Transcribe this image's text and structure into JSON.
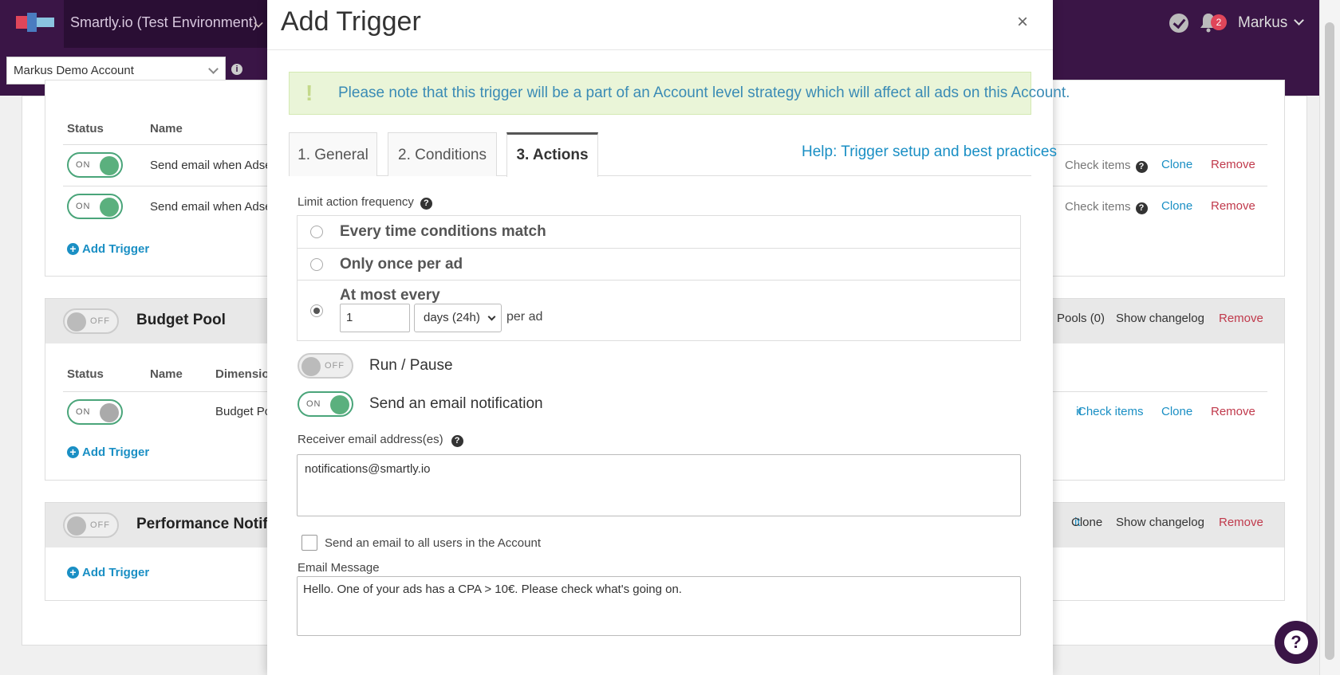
{
  "topbar": {
    "environment": "Smartly.io (Test Environment)",
    "notification_count": "2",
    "user_name": "Markus"
  },
  "account": {
    "selected": "Markus Demo Account",
    "info_icon": "i"
  },
  "panel1": {
    "columns": {
      "status": "Status",
      "name": "Name"
    },
    "rows": [
      {
        "toggle": "ON",
        "name": "Send email when Adse",
        "check_items": "Check items",
        "clone": "Clone",
        "remove": "Remove"
      },
      {
        "toggle": "ON",
        "name": "Send email when Adse",
        "check_items": "Check items",
        "clone": "Clone",
        "remove": "Remove"
      }
    ],
    "add_trigger": "Add Trigger"
  },
  "panel2": {
    "toggle": "OFF",
    "title": "Budget Pool",
    "pools": "Pools (0)",
    "show_changelog": "Show changelog",
    "remove": "Remove",
    "columns": {
      "status": "Status",
      "name": "Name",
      "dimension": "Dimensio"
    },
    "row": {
      "toggle": "ON",
      "dimension": "Budget Po",
      "edit": "it",
      "check_items": "Check items",
      "clone": "Clone",
      "remove": "Remove"
    },
    "add_trigger": "Add Trigger"
  },
  "panel3": {
    "toggle": "OFF",
    "title": "Performance Notifica",
    "edit": "it",
    "clone": "Clone",
    "show_changelog": "Show changelog",
    "remove": "Remove",
    "add_trigger": "Add Trigger"
  },
  "modal": {
    "title": "Add Trigger",
    "close": "×",
    "alert_mark": "!",
    "alert": "Please note that this trigger will be a part of an Account level strategy which will affect all ads on this Account.",
    "tabs": [
      {
        "label": "1. General"
      },
      {
        "label": "2. Conditions"
      },
      {
        "label": "3. Actions"
      }
    ],
    "help_link": "Help: Trigger setup and best practices",
    "limit_label": "Limit action frequency",
    "options": [
      {
        "label": "Every time conditions match"
      },
      {
        "label": "Only once per ad"
      },
      {
        "label": "At most every"
      }
    ],
    "frequency_value": "1",
    "frequency_unit": "days (24h)",
    "per_ad": "per ad",
    "run_pause": {
      "toggle": "OFF",
      "label": "Run / Pause"
    },
    "email_notify": {
      "toggle": "ON",
      "label": "Send an email notification"
    },
    "receiver_label": "Receiver email address(es)",
    "receiver_value": "notifications@smartly.io",
    "all_users_label": "Send an email to all users in the Account",
    "message_label": "Email Message",
    "message_value": "Hello. One of your ads has a CPA > 10€. Please check what's going on."
  },
  "help_fab": "?",
  "colors": {
    "brand": "#3a1546",
    "link": "#1a8fc4",
    "danger": "#c0394b",
    "toggle_on": "#5bb07e",
    "alert_bg": "#eaf5d8"
  }
}
